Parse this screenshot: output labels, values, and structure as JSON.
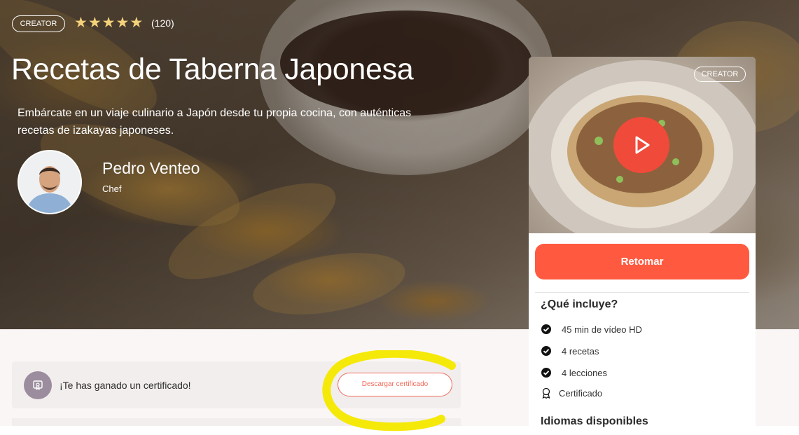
{
  "hero": {
    "badge": "CREATOR",
    "rating_value": 5,
    "rating_count": "(120)",
    "title": "Recetas de Taberna Japonesa",
    "description": "Embárcate en un viaje culinario a Japón desde tu propia cocina, con auténticas recetas de izakayas japoneses.",
    "chef": {
      "name": "Pedro Venteo",
      "role": "Chef"
    }
  },
  "card": {
    "badge": "CREATOR",
    "resume_label": "Retomar",
    "includes_title": "¿Qué incluye?",
    "includes": [
      {
        "icon": "check-circle-icon",
        "text": "45 min de vídeo HD"
      },
      {
        "icon": "check-circle-icon",
        "text": "4 recetas"
      },
      {
        "icon": "check-circle-icon",
        "text": "4 lecciones"
      },
      {
        "icon": "certificate-icon",
        "text": "Certificado"
      }
    ],
    "languages_title": "Idiomas disponibles"
  },
  "certificate": {
    "message": "¡Te has ganado un certificado!",
    "button_label": "Descargar certificado"
  },
  "colors": {
    "accent": "#ff5a40",
    "play": "#f04a3a",
    "star": "#f3d27a",
    "highlight": "#f5e90a"
  }
}
